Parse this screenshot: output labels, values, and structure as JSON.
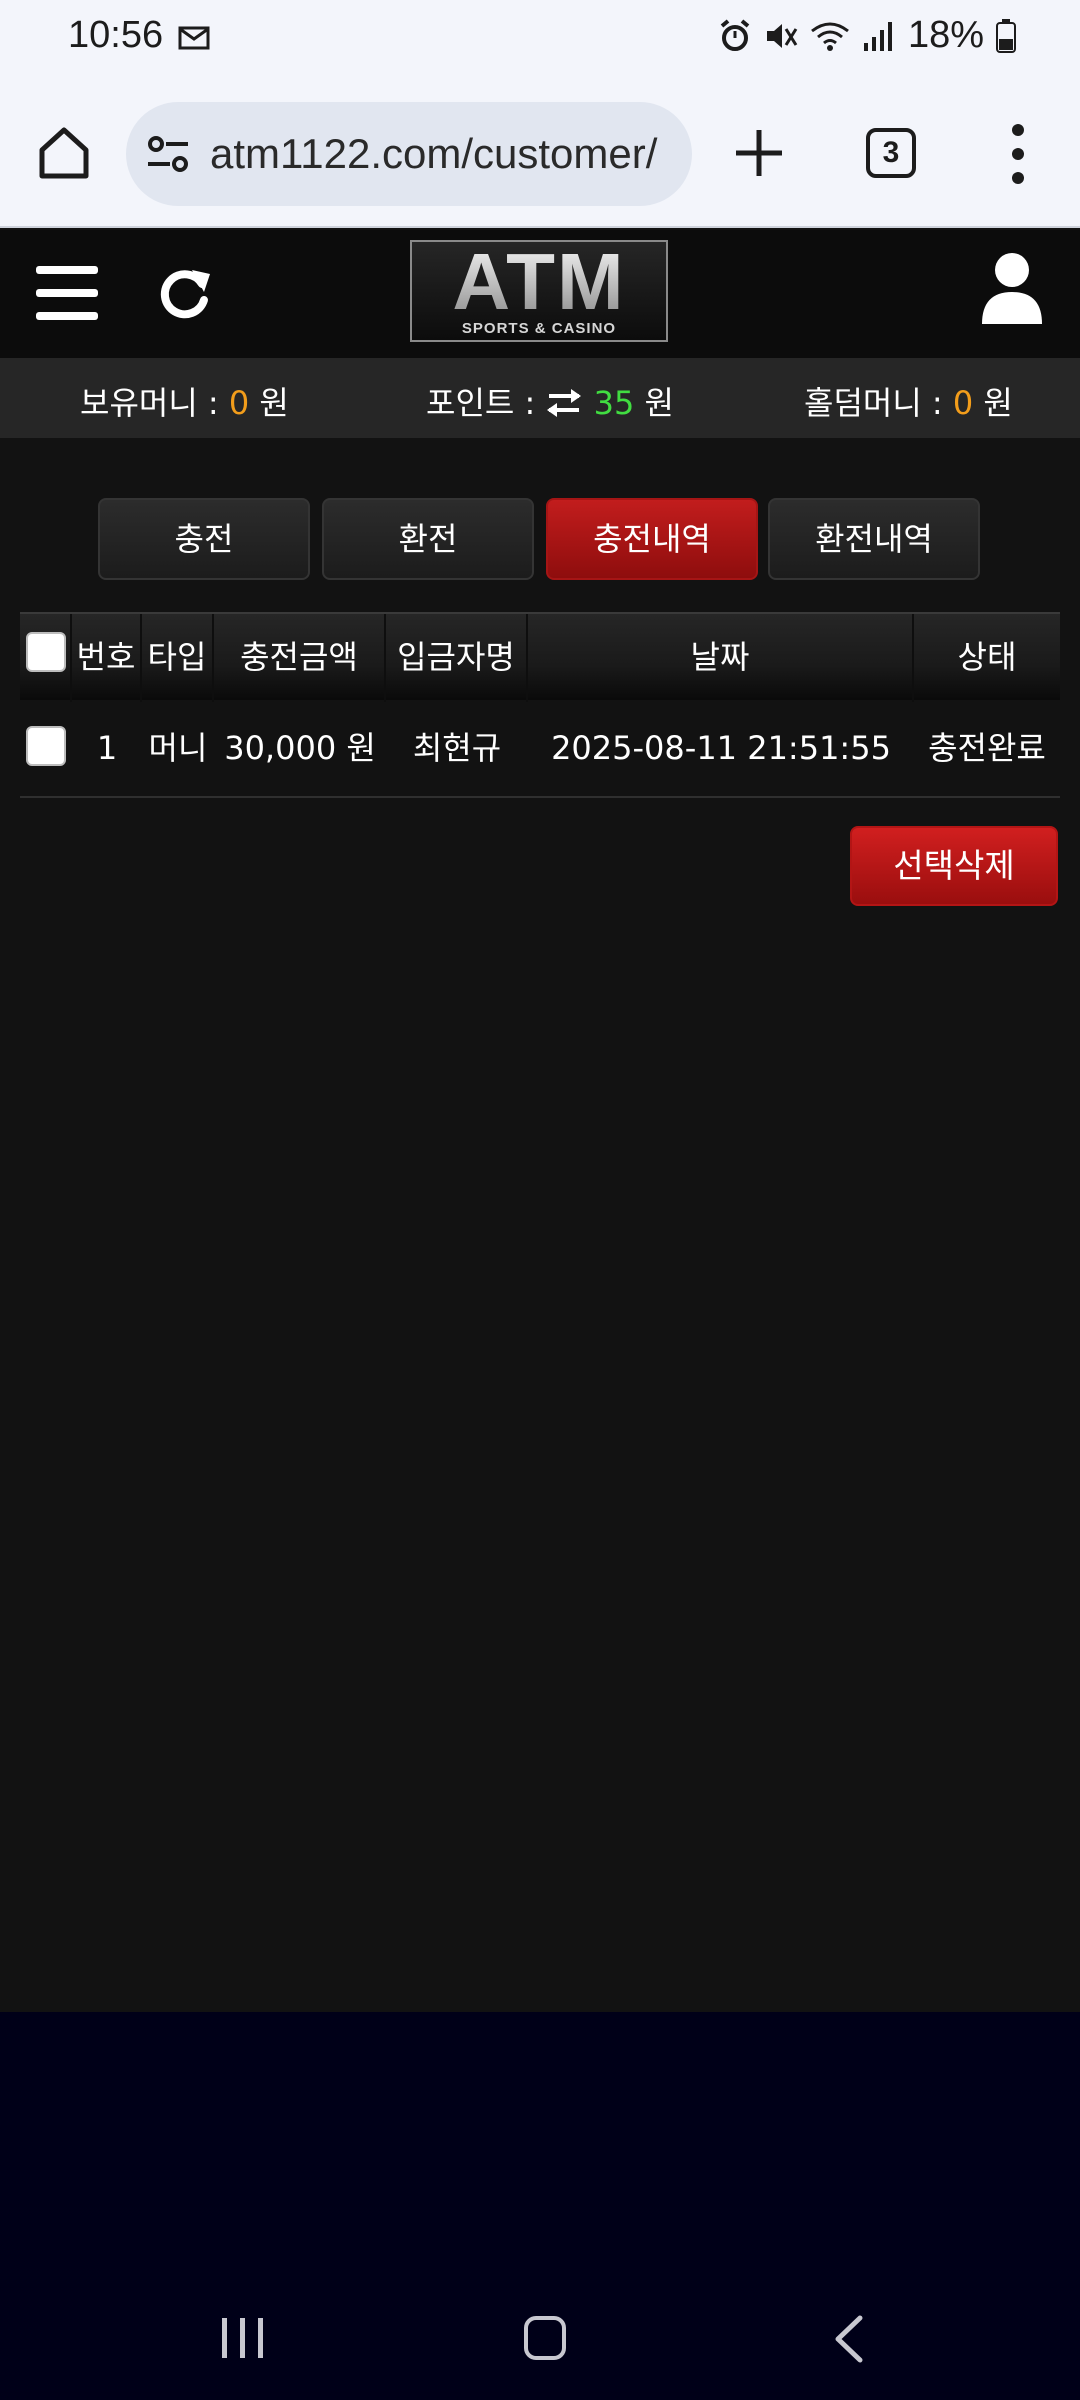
{
  "status_bar": {
    "time": "10:56",
    "battery": "18%"
  },
  "browser": {
    "url": "atm1122.com/customer/",
    "tab_count": "3"
  },
  "header": {
    "logo_main": "ATM",
    "logo_sub": "SPORTS & CASINO"
  },
  "money_bar": {
    "balance_label": "보유머니 :",
    "balance_value": "0",
    "points_label": "포인트 :",
    "points_value": "35",
    "hold_label": "홀덤머니 :",
    "hold_value": "0",
    "unit": "원"
  },
  "tabs": [
    {
      "label": "충전",
      "active": false
    },
    {
      "label": "환전",
      "active": false
    },
    {
      "label": "충전내역",
      "active": true
    },
    {
      "label": "환전내역",
      "active": false
    }
  ],
  "table": {
    "headers": [
      "번호",
      "타입",
      "충전금액",
      "입금자명",
      "날짜",
      "상태"
    ],
    "rows": [
      {
        "no": "1",
        "type": "머니",
        "amount": "30,000 원",
        "depositor": "최현규",
        "date": "2025-08-11 21:51:55",
        "status": "충전완료"
      }
    ]
  },
  "actions": {
    "delete_selected": "선택삭제"
  },
  "colors": {
    "accent_red": "#b51515",
    "money_orange": "#f29d1b",
    "points_green": "#41dd41",
    "page_bg": "#121212"
  }
}
